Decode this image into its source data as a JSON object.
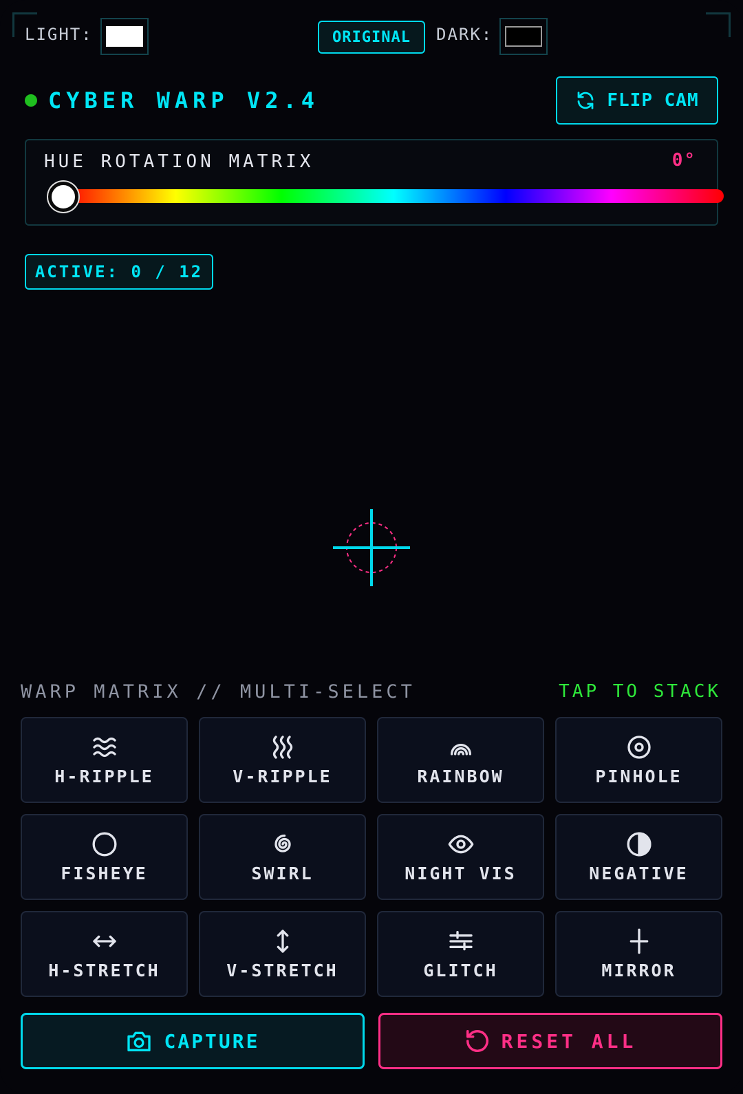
{
  "topbar": {
    "light_label": "LIGHT:",
    "dark_label": "DARK:",
    "original_label": "ORIGINAL",
    "light_color": "#ffffff",
    "dark_color": "#000000"
  },
  "header": {
    "title": "CYBER WARP V2.4",
    "status_color": "#1fbf1f",
    "flip_cam_label": "FLIP CAM",
    "flip_cam_icon": "refresh-icon"
  },
  "hue": {
    "title": "HUE ROTATION MATRIX",
    "value": "0°",
    "fraction": 0
  },
  "active_badge": "ACTIVE: 0 / 12",
  "matrix": {
    "title": "WARP MATRIX // MULTI-SELECT",
    "hint": "TAP TO STACK",
    "tiles": [
      {
        "label": "H-RIPPLE",
        "icon": "waves-icon"
      },
      {
        "label": "V-RIPPLE",
        "icon": "vertical-waves-icon"
      },
      {
        "label": "RAINBOW",
        "icon": "rainbow-icon"
      },
      {
        "label": "PINHOLE",
        "icon": "target-icon"
      },
      {
        "label": "FISHEYE",
        "icon": "circle-icon"
      },
      {
        "label": "SWIRL",
        "icon": "spiral-icon"
      },
      {
        "label": "NIGHT VIS",
        "icon": "eye-icon"
      },
      {
        "label": "NEGATIVE",
        "icon": "contrast-icon"
      },
      {
        "label": "H-STRETCH",
        "icon": "horizontal-arrows-icon"
      },
      {
        "label": "V-STRETCH",
        "icon": "vertical-arrows-icon"
      },
      {
        "label": "GLITCH",
        "icon": "glitch-lines-icon"
      },
      {
        "label": "MIRROR",
        "icon": "mirror-axis-icon"
      }
    ]
  },
  "actions": {
    "capture_label": "CAPTURE",
    "reset_label": "RESET ALL"
  },
  "colors": {
    "accent": "#00e5f5",
    "danger": "#ff2f86",
    "success": "#2ee83a",
    "background": "#05050a"
  }
}
